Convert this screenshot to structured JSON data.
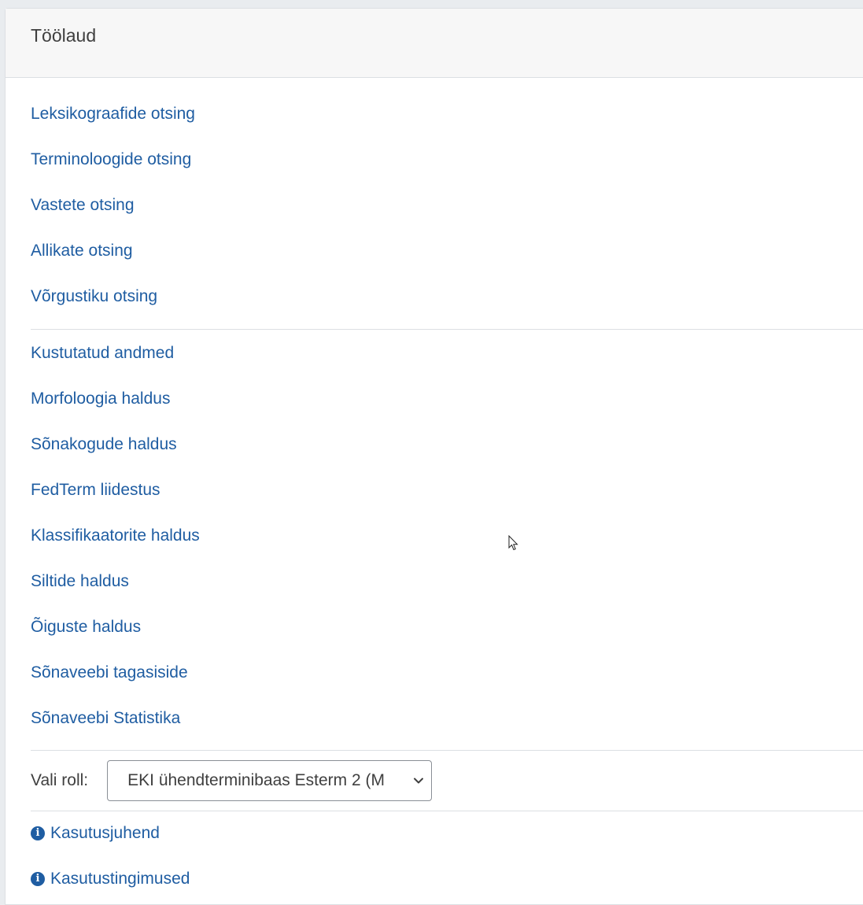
{
  "header": {
    "title": "Töölaud"
  },
  "search_links": [
    {
      "label": "Leksikograafide otsing"
    },
    {
      "label": "Terminoloogide otsing"
    },
    {
      "label": "Vastete otsing"
    },
    {
      "label": "Allikate otsing"
    },
    {
      "label": "Võrgustiku otsing"
    }
  ],
  "admin_links": [
    {
      "label": "Kustutatud andmed"
    },
    {
      "label": "Morfoloogia haldus"
    },
    {
      "label": "Sõnakogude haldus"
    },
    {
      "label": "FedTerm liidestus"
    },
    {
      "label": "Klassifikaatorite haldus"
    },
    {
      "label": "Siltide haldus"
    },
    {
      "label": "Õiguste haldus"
    },
    {
      "label": "Sõnaveebi tagasiside"
    },
    {
      "label": "Sõnaveebi Statistika"
    }
  ],
  "role": {
    "label": "Vali roll:",
    "selected": "EKI ühendterminibaas Esterm 2 (M"
  },
  "info_links": [
    {
      "label": "Kasutusjuhend",
      "icon": "info-circle-icon"
    },
    {
      "label": "Kasutustingimused",
      "icon": "info-circle-icon"
    }
  ],
  "colors": {
    "link": "#1f5da2",
    "header_bg": "#f7f7f7",
    "text": "#3f3f3f"
  }
}
